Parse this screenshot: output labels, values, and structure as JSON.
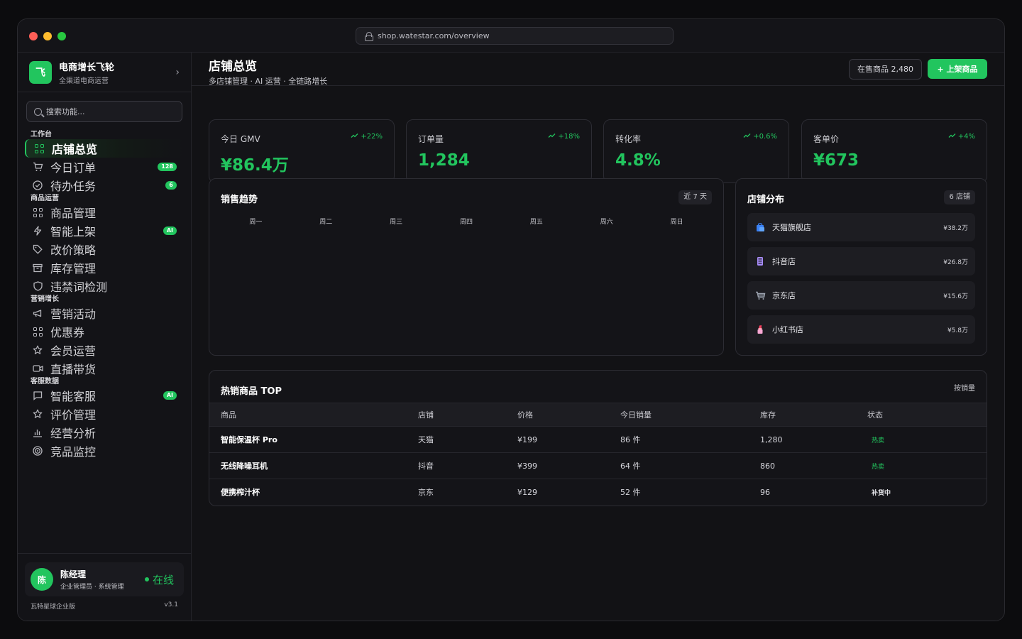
{
  "browser": {
    "url": "shop.watestar.com/overview"
  },
  "brand": {
    "logo": "飞",
    "name": "电商增长飞轮",
    "subtitle": "全渠道电商运营"
  },
  "search": {
    "placeholder": "搜索功能..."
  },
  "nav": [
    {
      "group": "工作台",
      "items": [
        {
          "label": "店铺总览",
          "icon": "grid-icon",
          "active": true,
          "badge": ""
        },
        {
          "label": "今日订单",
          "icon": "cart-icon",
          "badge": "128"
        },
        {
          "label": "待办任务",
          "icon": "check-circle-icon",
          "badge": "6"
        }
      ]
    },
    {
      "group": "商品运营",
      "items": [
        {
          "label": "商品管理",
          "icon": "grid-icon",
          "badge": ""
        },
        {
          "label": "智能上架",
          "icon": "bolt-icon",
          "badge": "AI"
        },
        {
          "label": "改价策略",
          "icon": "tag-icon",
          "badge": ""
        },
        {
          "label": "库存管理",
          "icon": "archive-icon",
          "badge": ""
        },
        {
          "label": "违禁词检测",
          "icon": "shield-icon",
          "badge": ""
        }
      ]
    },
    {
      "group": "营销增长",
      "items": [
        {
          "label": "营销活动",
          "icon": "megaphone-icon",
          "badge": ""
        },
        {
          "label": "优惠券",
          "icon": "grid-icon",
          "badge": ""
        },
        {
          "label": "会员运营",
          "icon": "star-icon",
          "badge": ""
        },
        {
          "label": "直播带货",
          "icon": "video-icon",
          "badge": ""
        }
      ]
    },
    {
      "group": "客服数据",
      "items": [
        {
          "label": "智能客服",
          "icon": "chat-icon",
          "badge": "AI"
        },
        {
          "label": "评价管理",
          "icon": "star-icon",
          "badge": ""
        },
        {
          "label": "经营分析",
          "icon": "bar-chart-icon",
          "badge": ""
        },
        {
          "label": "竞品监控",
          "icon": "target-icon",
          "badge": ""
        }
      ]
    }
  ],
  "user": {
    "avatar": "陈",
    "name": "陈经理",
    "role": "企业管理员 · 系统管理",
    "status": "在线"
  },
  "footer": {
    "edition": "瓦特星球企业版",
    "version": "v3.1"
  },
  "header": {
    "title": "店铺总览",
    "subtitle": "多店铺管理 · AI 运营 · 全链路增长",
    "on_sale": "在售商品 2,480",
    "add_button": "+ 上架商品"
  },
  "kpis": [
    {
      "label": "今日 GMV",
      "delta": "+22%",
      "value": "¥86.4万"
    },
    {
      "label": "订单量",
      "delta": "+18%",
      "value": "1,284"
    },
    {
      "label": "转化率",
      "delta": "+0.6%",
      "value": "4.8%"
    },
    {
      "label": "客单价",
      "delta": "+4%",
      "value": "¥673"
    }
  ],
  "sales_trend": {
    "title": "销售趋势",
    "range": "近 7 天",
    "days": [
      "周一",
      "周二",
      "周三",
      "周四",
      "周五",
      "周六",
      "周日"
    ]
  },
  "stores": {
    "title": "店铺分布",
    "count": "6 店铺",
    "items": [
      {
        "name": "天猫旗舰店",
        "amount": "¥38.2万",
        "icon": "shopping-bag-icon",
        "color": "#3b82f6"
      },
      {
        "name": "抖音店",
        "amount": "¥26.8万",
        "icon": "phone-icon",
        "color": "#a78bfa"
      },
      {
        "name": "京东店",
        "amount": "¥15.6万",
        "icon": "cart-icon",
        "color": "#9ca3af"
      },
      {
        "name": "小红书店",
        "amount": "¥5.8万",
        "icon": "lipstick-icon",
        "color": "#f43f5e"
      }
    ]
  },
  "hot_products": {
    "title": "热销商品 TOP",
    "sort": "按销量",
    "columns": [
      "商品",
      "店铺",
      "价格",
      "今日销量",
      "库存",
      "状态"
    ],
    "rows": [
      {
        "name": "智能保温杯 Pro",
        "store": "天猫",
        "price": "¥199",
        "sales": "86 件",
        "stock": "1,280",
        "status": "热卖",
        "status_type": "hot"
      },
      {
        "name": "无线降噪耳机",
        "store": "抖音",
        "price": "¥399",
        "sales": "64 件",
        "stock": "860",
        "status": "热卖",
        "status_type": "hot"
      },
      {
        "name": "便携榨汁杯",
        "store": "京东",
        "price": "¥129",
        "sales": "52 件",
        "stock": "96",
        "status": "补货中",
        "status_type": "restock"
      }
    ]
  },
  "colors": {
    "accent": "#22c55e",
    "background": "#121215"
  }
}
